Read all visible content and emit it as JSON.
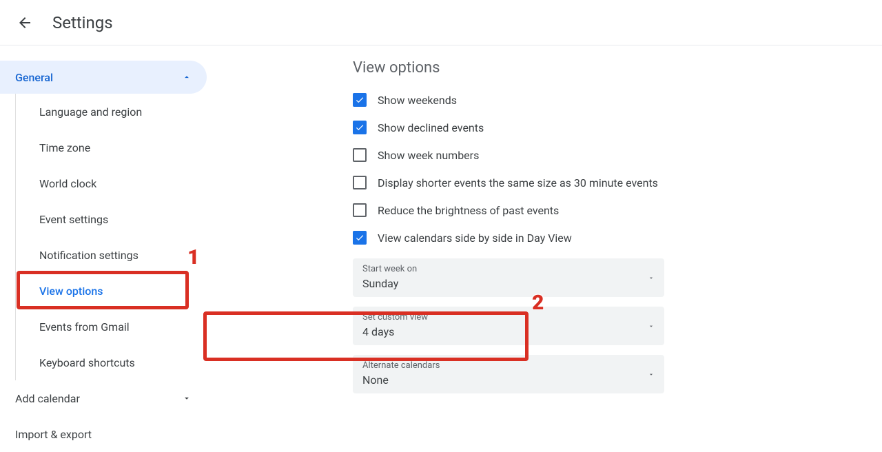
{
  "header": {
    "title": "Settings"
  },
  "sidebar": {
    "section_label": "General",
    "items": [
      {
        "label": "Language and region"
      },
      {
        "label": "Time zone"
      },
      {
        "label": "World clock"
      },
      {
        "label": "Event settings"
      },
      {
        "label": "Notification settings"
      },
      {
        "label": "View options"
      },
      {
        "label": "Events from Gmail"
      },
      {
        "label": "Keyboard shortcuts"
      }
    ],
    "add_calendar": "Add calendar",
    "import_export": "Import & export"
  },
  "main": {
    "section_title": "View options",
    "checks": [
      {
        "label": "Show weekends",
        "checked": true
      },
      {
        "label": "Show declined events",
        "checked": true
      },
      {
        "label": "Show week numbers",
        "checked": false
      },
      {
        "label": "Display shorter events the same size as 30 minute events",
        "checked": false
      },
      {
        "label": "Reduce the brightness of past events",
        "checked": false
      },
      {
        "label": "View calendars side by side in Day View",
        "checked": true
      }
    ],
    "dropdowns": {
      "start_week": {
        "label": "Start week on",
        "value": "Sunday"
      },
      "custom_view": {
        "label": "Set custom view",
        "value": "4 days"
      },
      "alt_cal": {
        "label": "Alternate calendars",
        "value": "None"
      }
    }
  },
  "annotations": {
    "one": "1",
    "two": "2"
  }
}
